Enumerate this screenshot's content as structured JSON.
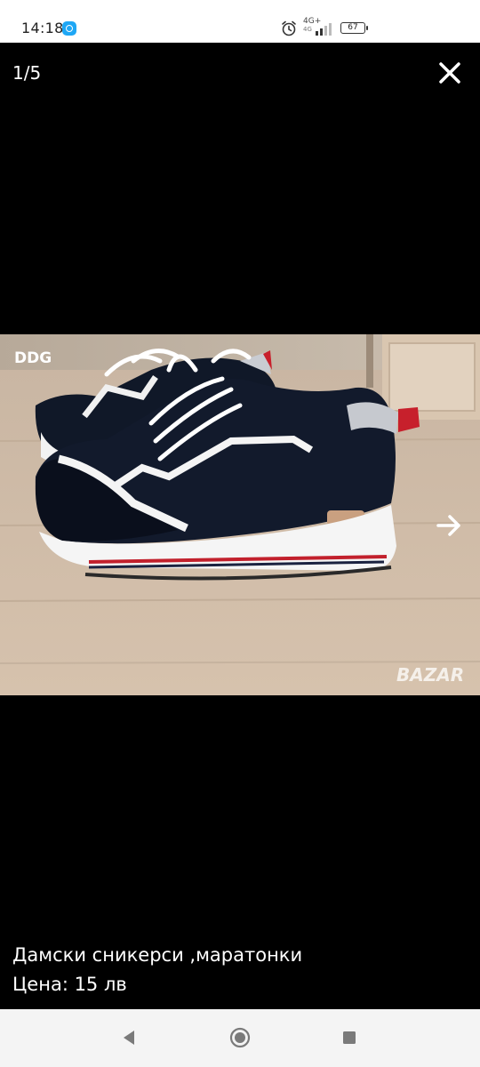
{
  "status_bar": {
    "time": "14:18",
    "network": "4G+",
    "network_sub": "4G",
    "battery": "67",
    "app_icon": "messenger-icon",
    "alarm_icon": "alarm-icon"
  },
  "viewer": {
    "counter": "1/5",
    "close_icon": "close-icon",
    "next_icon": "arrow-right-icon",
    "image": {
      "description_icon": "sneaker-photo",
      "overlay_label": "DDG",
      "watermark": "BAZAR"
    }
  },
  "listing": {
    "title": "Дамски сникерси ,маратонки",
    "price_line": "Цена: 15 лв"
  },
  "nav_bar": {
    "back_icon": "back-icon",
    "home_icon": "home-icon",
    "recent_icon": "recent-apps-icon"
  },
  "colors": {
    "background": "#000000",
    "status_bar": "#ffffff",
    "nav_bar": "#f4f4f4",
    "text": "#ffffff"
  }
}
